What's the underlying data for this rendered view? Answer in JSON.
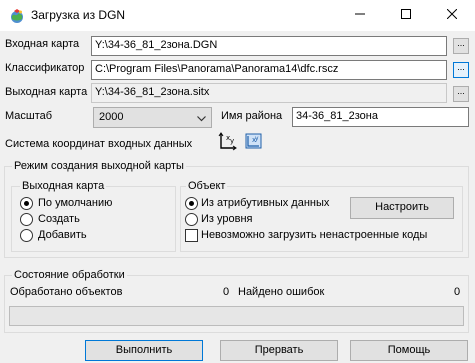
{
  "window": {
    "title": "Загрузка из DGN"
  },
  "form": {
    "input_map_label": "Входная карта",
    "input_map_value": "Y:\\34-36_81_2зона.DGN",
    "classifier_label": "Классификатор",
    "classifier_value": "C:\\Program Files\\Panorama\\Panorama14\\dfc.rscz",
    "output_map_label": "Выходная карта",
    "output_map_value": "Y:\\34-36_81_2зона.sitx",
    "browse_label": "...",
    "scale_label": "Масштаб",
    "scale_value": "2000",
    "region_label": "Имя района",
    "region_value": "34-36_81_2зона",
    "crs_label": "Система координат входных данных"
  },
  "mode_group": {
    "title": "Режим создания выходной карты",
    "output_map_group": {
      "title": "Выходная карта",
      "options": [
        "По умолчанию",
        "Создать",
        "Добавить"
      ],
      "selected_index": 0
    },
    "object_group": {
      "title": "Объект",
      "options": [
        "Из атрибутивных данных",
        "Из уровня"
      ],
      "selected_index": 0,
      "checkbox_label": "Невозможно загрузить ненастроенные коды",
      "checkbox_checked": false,
      "configure_button": "Настроить"
    }
  },
  "status_group": {
    "title": "Состояние обработки",
    "processed_label": "Обработано объектов",
    "processed_value": "0",
    "errors_label": "Найдено ошибок",
    "errors_value": "0",
    "progress": 0
  },
  "buttons": {
    "run": "Выполнить",
    "abort": "Прервать",
    "help": "Помощь"
  },
  "icons": {
    "app": "app-globe-icon",
    "minimize": "minimize-icon",
    "maximize": "maximize-icon",
    "close": "close-icon",
    "crs_xy": "crs-xy-icon",
    "crs_transform": "crs-transform-icon",
    "dropdown": "chevron-down-icon"
  },
  "colors": {
    "focus_blue": "#0078d7",
    "window_bg": "#f0f0f0"
  }
}
